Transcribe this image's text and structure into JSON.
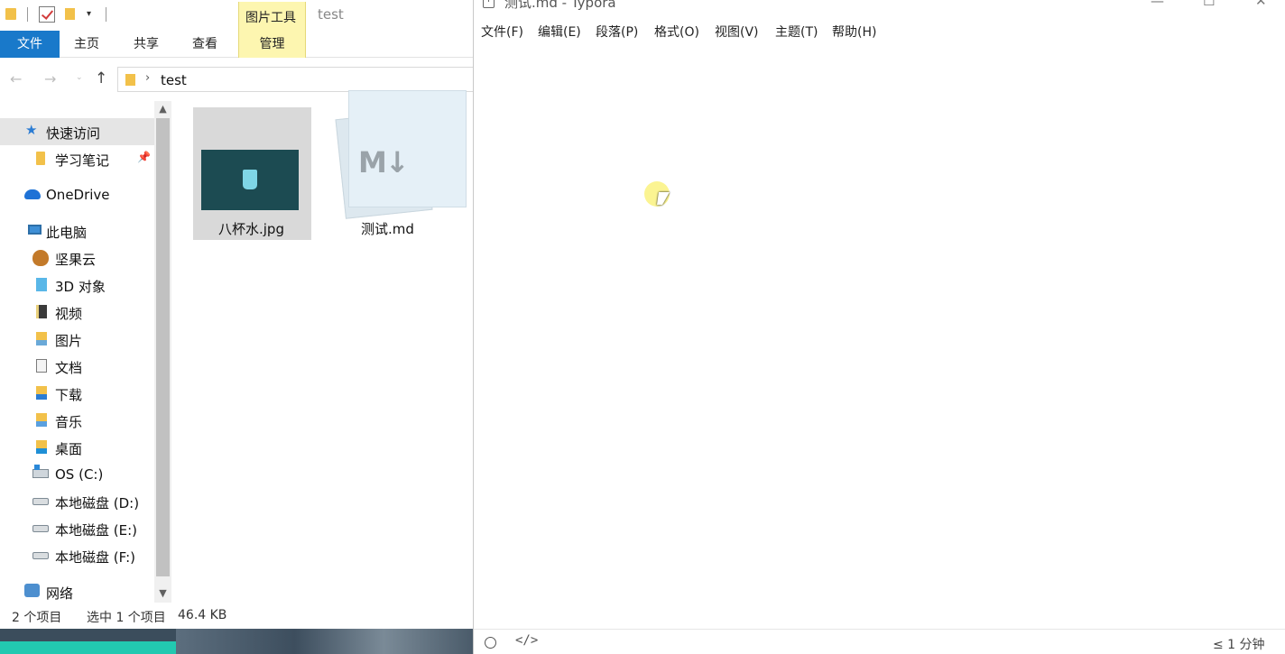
{
  "explorer": {
    "quick_access_toolbar": {
      "dropdown_glyph": "▾"
    },
    "context_tab_label": "图片工具",
    "window_title": "test",
    "ribbon_tabs": [
      {
        "label": "文件"
      },
      {
        "label": "主页"
      },
      {
        "label": "共享"
      },
      {
        "label": "查看"
      },
      {
        "label": "管理"
      }
    ],
    "address": {
      "back_glyph": "←",
      "forward_glyph": "→",
      "recent_glyph": "⌄",
      "up_glyph": "↑",
      "chevron": "›",
      "path": "test"
    },
    "nav_pane": [
      {
        "label": "快速访问",
        "icon": "star-icon"
      },
      {
        "label": "学习笔记",
        "icon": "folder-icon",
        "pinned": true
      },
      {
        "label": "OneDrive",
        "icon": "cloud-icon"
      },
      {
        "label": "此电脑",
        "icon": "pc-icon"
      },
      {
        "label": "坚果云",
        "icon": "nut-icon"
      },
      {
        "label": "3D 对象",
        "icon": "3d-objects-icon"
      },
      {
        "label": "视频",
        "icon": "video-icon"
      },
      {
        "label": "图片",
        "icon": "pictures-icon"
      },
      {
        "label": "文档",
        "icon": "documents-icon"
      },
      {
        "label": "下载",
        "icon": "downloads-icon"
      },
      {
        "label": "音乐",
        "icon": "music-icon"
      },
      {
        "label": "桌面",
        "icon": "desktop-icon"
      },
      {
        "label": "OS (C:)",
        "icon": "os-drive-icon"
      },
      {
        "label": "本地磁盘 (D:)",
        "icon": "drive-icon"
      },
      {
        "label": "本地磁盘 (E:)",
        "icon": "drive-icon"
      },
      {
        "label": "本地磁盘 (F:)",
        "icon": "drive-icon"
      },
      {
        "label": "网络",
        "icon": "network-icon"
      }
    ],
    "pin_glyph": "📌",
    "scrollbar": {
      "up_glyph": "▲",
      "down_glyph": "▼"
    },
    "files": [
      {
        "name": "八杯水.jpg",
        "selected": true
      },
      {
        "name": "测试.md",
        "selected": false
      }
    ],
    "md_logo": "M↓",
    "status": {
      "item_count": "2 个项目",
      "selected": "选中 1 个项目",
      "size": "46.4 KB"
    }
  },
  "typora": {
    "logo_glyph": "T",
    "title": "测试.md - Typora",
    "controls": {
      "minimize": "—",
      "maximize": "☐",
      "close": "✕"
    },
    "menu": [
      {
        "label": "文件(F)"
      },
      {
        "label": "编辑(E)"
      },
      {
        "label": "段落(P)"
      },
      {
        "label": "格式(O)"
      },
      {
        "label": "视图(V)"
      },
      {
        "label": "主题(T)"
      },
      {
        "label": "帮助(H)"
      }
    ],
    "footer": {
      "source_code_glyph": "</>",
      "word_count": "≤ 1 分钟"
    }
  },
  "colors": {
    "ribbon_file_tab": "#1979ca",
    "context_tab": "#fdf6b0",
    "nav_selected": "#e5e5e5",
    "cursor_highlight": "#faf06e"
  }
}
